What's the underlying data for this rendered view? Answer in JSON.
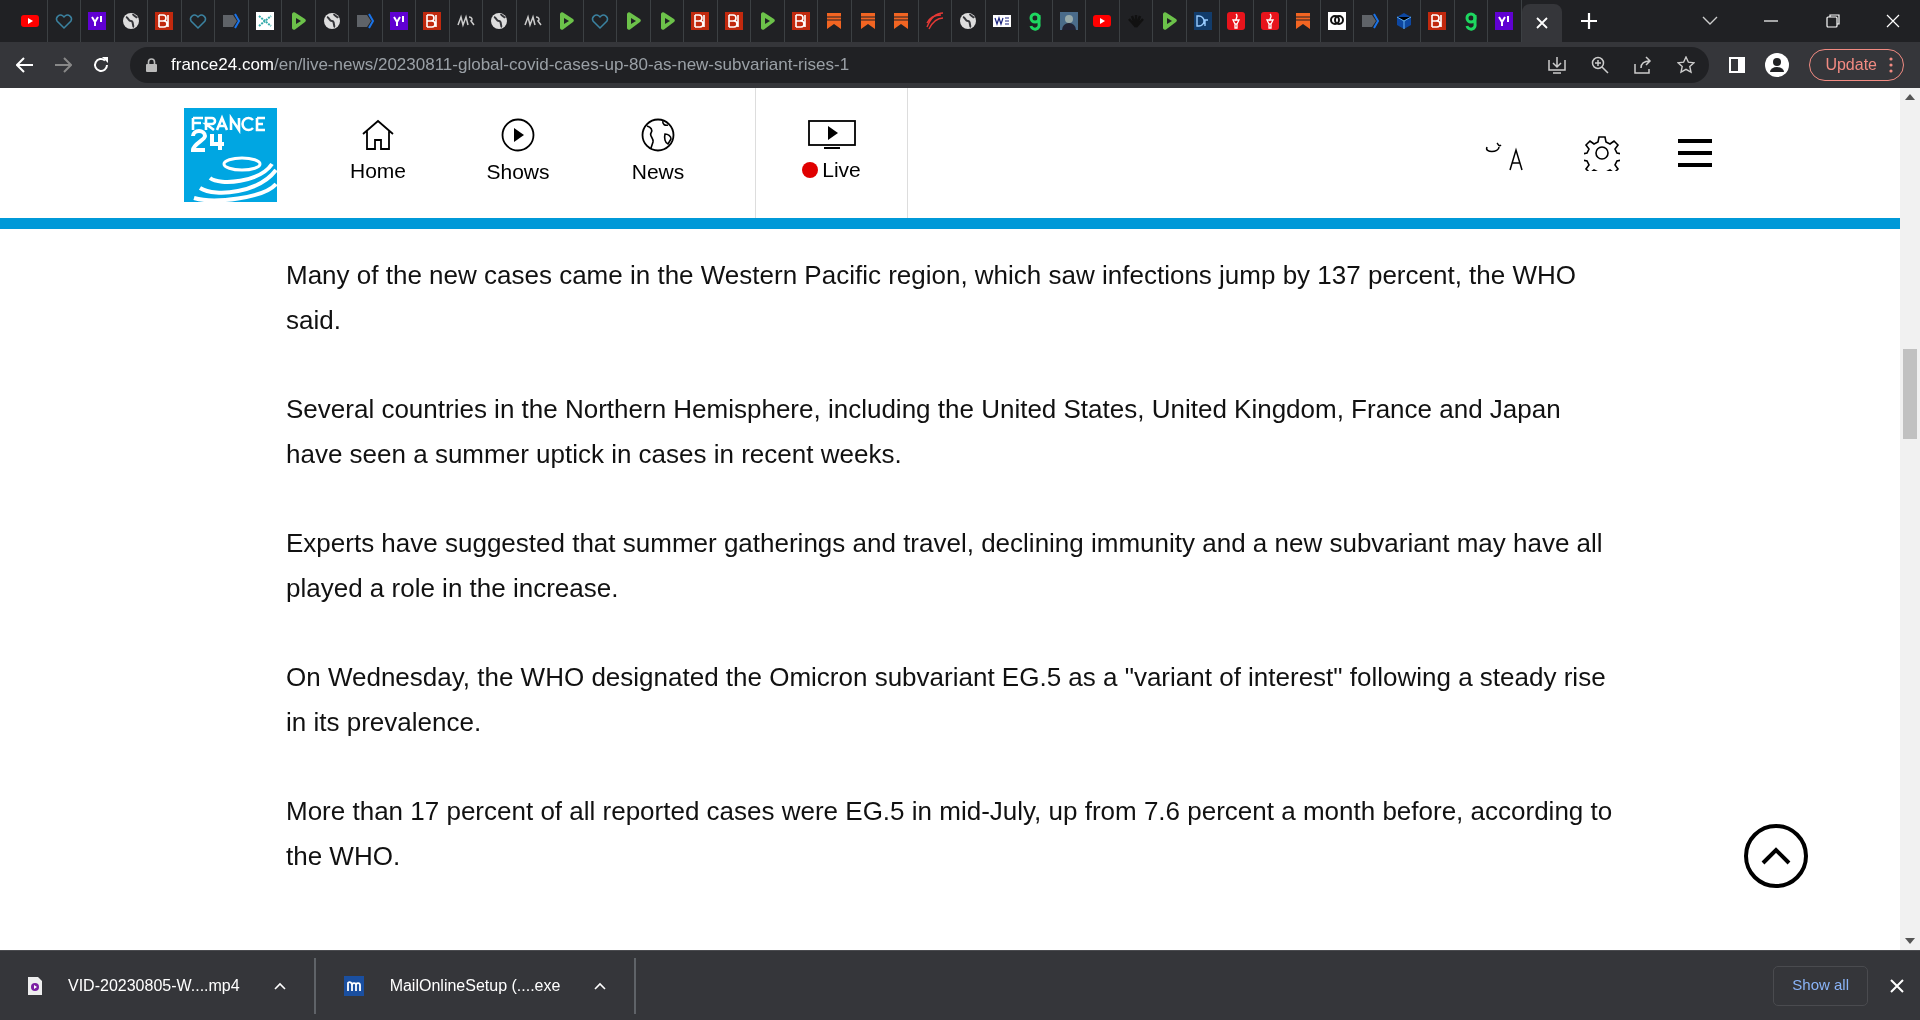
{
  "tabs": [
    {
      "kind": "youtube"
    },
    {
      "kind": "heart"
    },
    {
      "kind": "yahoo"
    },
    {
      "kind": "globe"
    },
    {
      "kind": "bi"
    },
    {
      "kind": "heart"
    },
    {
      "kind": "arrow"
    },
    {
      "kind": "grid"
    },
    {
      "kind": "play"
    },
    {
      "kind": "globe"
    },
    {
      "kind": "arrow"
    },
    {
      "kind": "yahoo"
    },
    {
      "kind": "bi"
    },
    {
      "kind": "script"
    },
    {
      "kind": "globe"
    },
    {
      "kind": "script"
    },
    {
      "kind": "play"
    },
    {
      "kind": "heart"
    },
    {
      "kind": "play"
    },
    {
      "kind": "play"
    },
    {
      "kind": "bi"
    },
    {
      "kind": "bi"
    },
    {
      "kind": "play"
    },
    {
      "kind": "bi"
    },
    {
      "kind": "bookmark"
    },
    {
      "kind": "bookmark"
    },
    {
      "kind": "bookmark"
    },
    {
      "kind": "spiral"
    },
    {
      "kind": "globe"
    },
    {
      "kind": "wsj"
    },
    {
      "kind": "g"
    },
    {
      "kind": "photo"
    },
    {
      "kind": "youtube"
    },
    {
      "kind": "nbc"
    },
    {
      "kind": "play"
    },
    {
      "kind": "dr"
    },
    {
      "kind": "torch"
    },
    {
      "kind": "torch"
    },
    {
      "kind": "bookmark"
    },
    {
      "kind": "cd"
    },
    {
      "kind": "arrow"
    },
    {
      "kind": "cube"
    },
    {
      "kind": "bi"
    },
    {
      "kind": "g"
    },
    {
      "kind": "yahoo"
    }
  ],
  "address_bar": {
    "domain": "france24.com",
    "path": "/en/live-news/20230811-global-covid-cases-up-80-as-new-subvariant-rises-1"
  },
  "update_button": "Update",
  "nav": [
    {
      "label": "Home",
      "kind": "home"
    },
    {
      "label": "Shows",
      "kind": "shows"
    },
    {
      "label": "News",
      "kind": "news"
    },
    {
      "label": "Live",
      "kind": "live"
    }
  ],
  "paragraphs": [
    "Many of the new cases came in the Western Pacific region, which saw infections jump by 137 percent, the WHO said.",
    "Several countries in the Northern Hemisphere, including the United States, United Kingdom, France and Japan have seen a summer uptick in cases in recent weeks.",
    "Experts have suggested that summer gatherings and travel, declining immunity and a new subvariant may have all played a role in the increase.",
    "On Wednesday, the WHO designated the Omicron subvariant EG.5 as a \"variant of interest\" following a steady rise in its prevalence.",
    "More than 17 percent of all reported cases were EG.5 in mid-July, up from 7.6 percent a month before, according to the WHO."
  ],
  "downloads": [
    {
      "name": "VID-20230805-W....mp4",
      "kind": "video"
    },
    {
      "name": "MailOnlineSetup (....exe",
      "kind": "app"
    }
  ],
  "show_all": "Show all"
}
